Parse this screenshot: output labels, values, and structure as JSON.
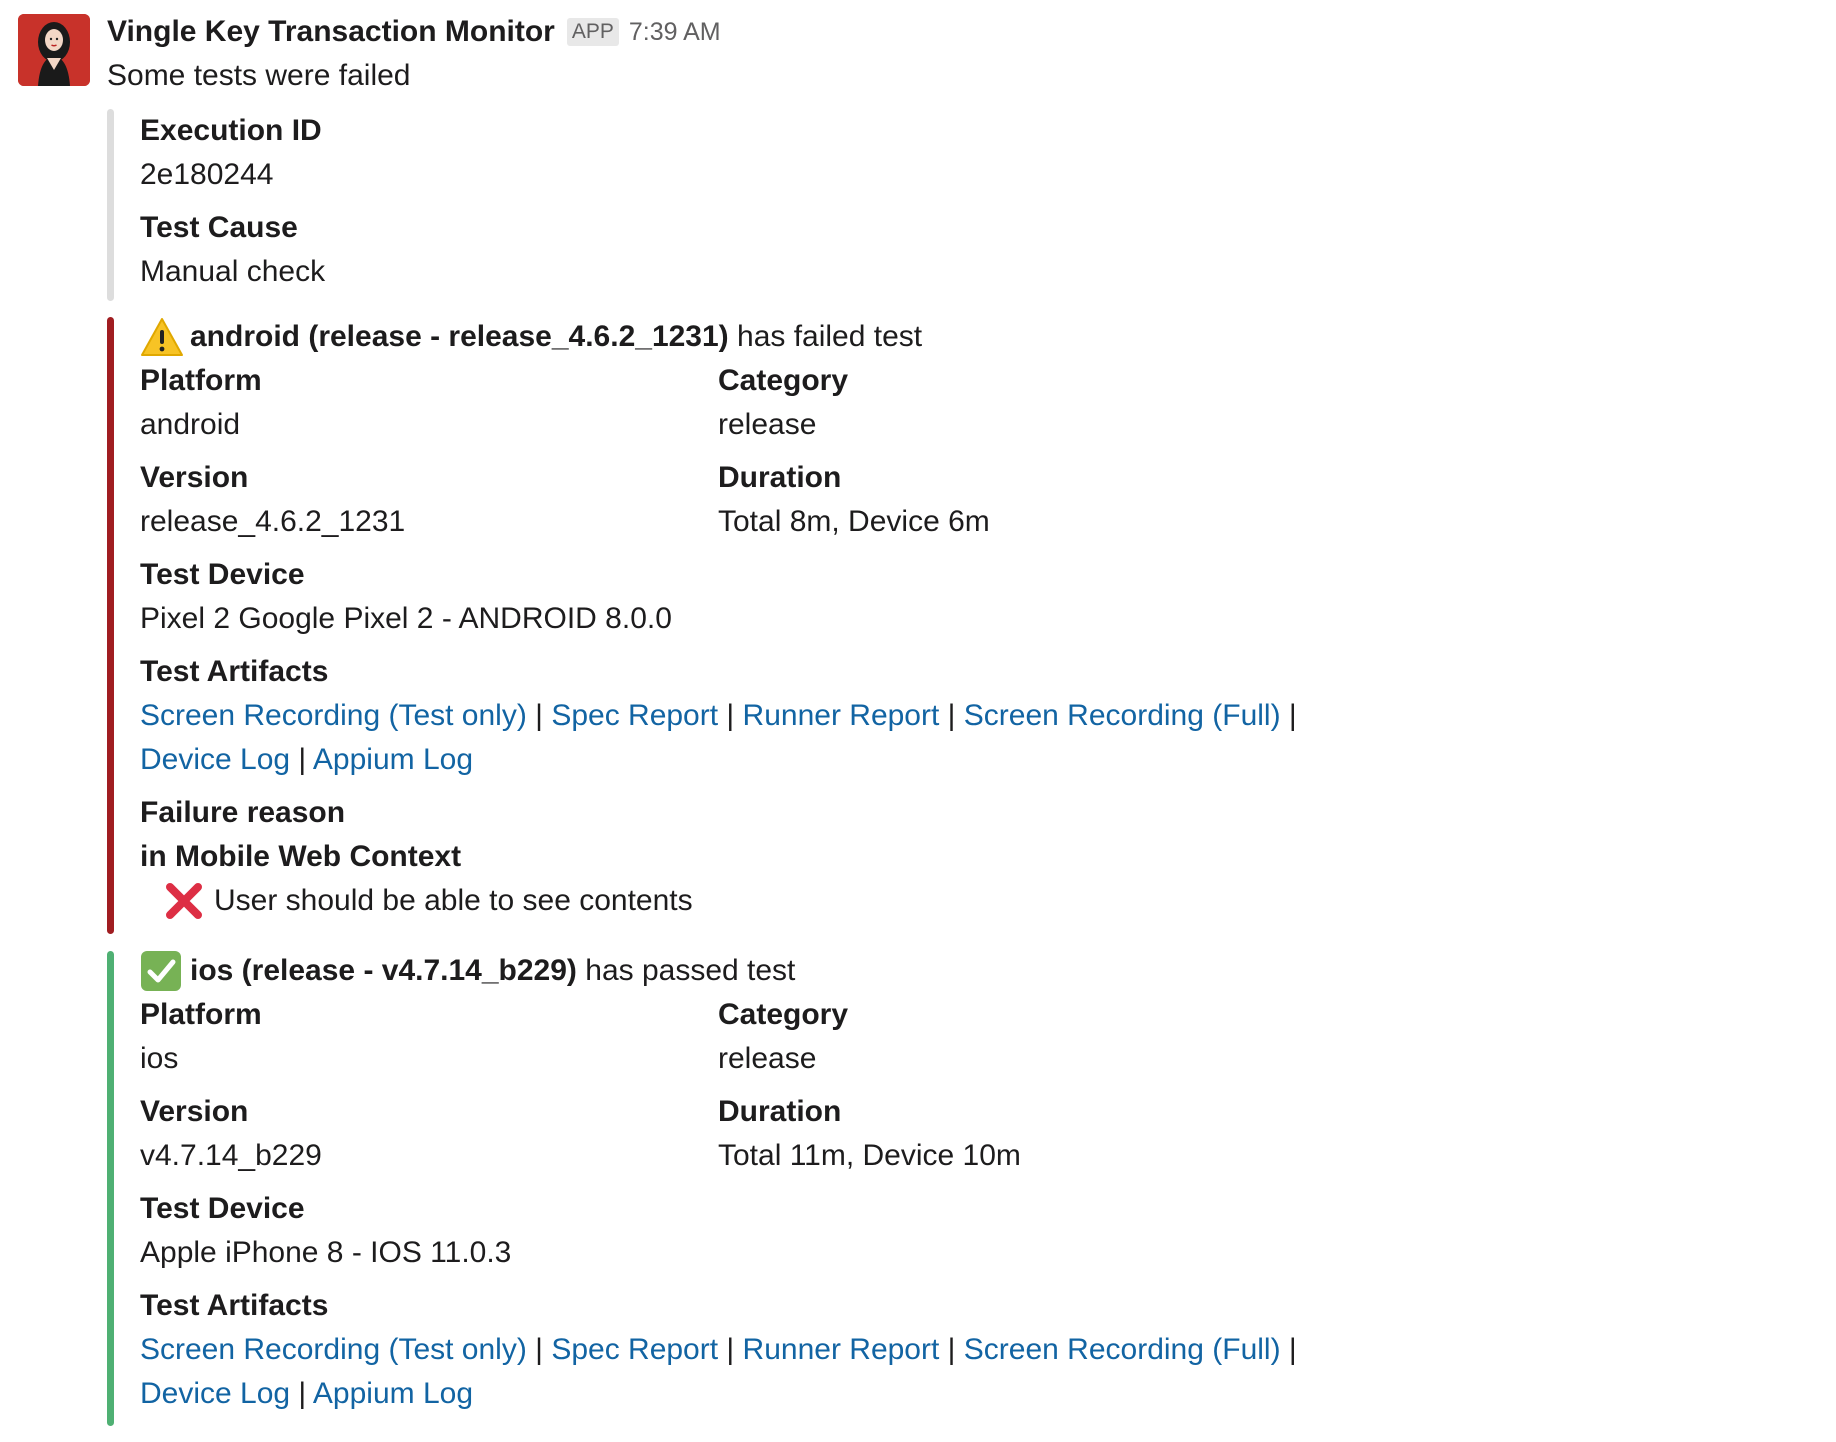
{
  "header": {
    "app_name": "Vingle Key Transaction Monitor",
    "badge": "APP",
    "time": "7:39 AM"
  },
  "message": {
    "text": "Some tests were failed"
  },
  "meta": {
    "execution_id_label": "Execution ID",
    "execution_id_value": "2e180244",
    "test_cause_label": "Test Cause",
    "test_cause_value": "Manual check"
  },
  "android": {
    "status_icon": "warning-icon",
    "title_bold": "android (release - release_4.6.2_1231)",
    "title_rest": " has failed test",
    "platform_label": "Platform",
    "platform_value": "android",
    "category_label": "Category",
    "category_value": "release",
    "version_label": "Version",
    "version_value": "release_4.6.2_1231",
    "duration_label": "Duration",
    "duration_value": "Total 8m, Device 6m",
    "device_label": "Test Device",
    "device_value": "Pixel 2 Google Pixel 2 - ANDROID 8.0.0",
    "artifacts_label": "Test Artifacts",
    "artifacts": [
      "Screen Recording (Test only)",
      "Spec Report",
      "Runner Report",
      "Screen Recording (Full)",
      "Device Log",
      "Appium Log"
    ],
    "failure_label": "Failure reason",
    "failure_context": "in Mobile Web Context",
    "failure_item": "User should be able to see contents"
  },
  "ios": {
    "status_icon": "check-icon",
    "title_bold": "ios (release - v4.7.14_b229)",
    "title_rest": " has passed test",
    "platform_label": "Platform",
    "platform_value": "ios",
    "category_label": "Category",
    "category_value": "release",
    "version_label": "Version",
    "version_value": "v4.7.14_b229",
    "duration_label": "Duration",
    "duration_value": "Total 11m, Device 10m",
    "device_label": "Test Device",
    "device_value": "Apple iPhone 8 - IOS 11.0.3",
    "artifacts_label": "Test Artifacts",
    "artifacts": [
      "Screen Recording (Test only)",
      "Spec Report",
      "Runner Report",
      "Screen Recording (Full)",
      "Device Log",
      "Appium Log"
    ]
  },
  "colors": {
    "link": "#1264a3",
    "failed_bar": "#a01d21",
    "passed_bar": "#4fb073",
    "neutral_bar": "#dddddd"
  }
}
